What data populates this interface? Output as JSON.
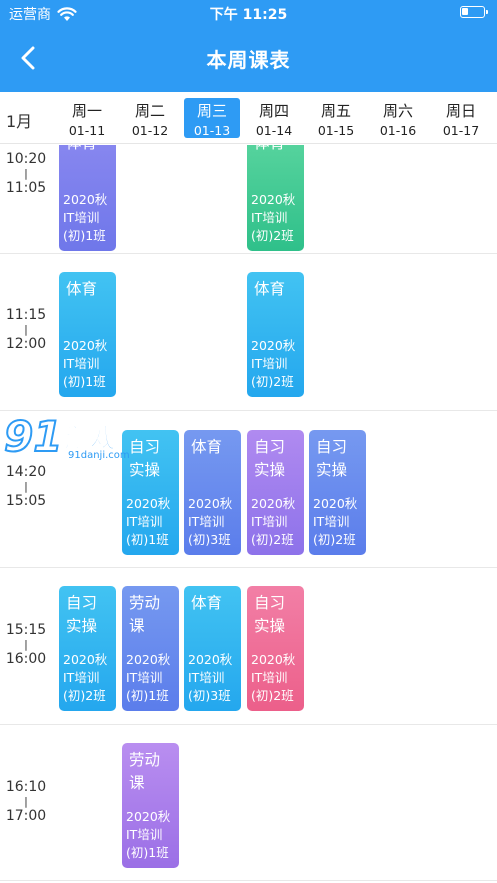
{
  "status_bar": {
    "carrier": "运营商",
    "time": "下午 11:25"
  },
  "nav": {
    "title": "本周课表"
  },
  "week": {
    "month": "1月",
    "days": [
      {
        "name": "周一",
        "date": "01-11",
        "selected": false
      },
      {
        "name": "周二",
        "date": "01-12",
        "selected": false
      },
      {
        "name": "周三",
        "date": "01-13",
        "selected": true
      },
      {
        "name": "周四",
        "date": "01-14",
        "selected": false
      },
      {
        "name": "周五",
        "date": "01-15",
        "selected": false
      },
      {
        "name": "周六",
        "date": "01-16",
        "selected": false
      },
      {
        "name": "周日",
        "date": "01-17",
        "selected": false
      }
    ]
  },
  "periods": [
    {
      "start": "10:20",
      "sep": "|",
      "end": "11:05"
    },
    {
      "start": "11:15",
      "sep": "|",
      "end": "12:00"
    },
    {
      "start": "14:20",
      "sep": "|",
      "end": "15:05"
    },
    {
      "start": "15:15",
      "sep": "|",
      "end": "16:00"
    },
    {
      "start": "16:10",
      "sep": "|",
      "end": "17:00"
    }
  ],
  "courses": [
    {
      "period": 0,
      "day": 0,
      "title": "体育",
      "class": "2020秋IT培训(初)1班",
      "color": "purple"
    },
    {
      "period": 0,
      "day": 3,
      "title": "体育",
      "class": "2020秋IT培训(初)2班",
      "color": "green"
    },
    {
      "period": 1,
      "day": 0,
      "title": "体育",
      "class": "2020秋IT培训(初)1班",
      "color": "blue"
    },
    {
      "period": 1,
      "day": 3,
      "title": "体育",
      "class": "2020秋IT培训(初)2班",
      "color": "blue"
    },
    {
      "period": 2,
      "day": 1,
      "title": "自习实操",
      "class": "2020秋IT培训(初)1班",
      "color": "blue"
    },
    {
      "period": 2,
      "day": 2,
      "title": "体育",
      "class": "2020秋IT培训(初)3班",
      "color": "indigo"
    },
    {
      "period": 2,
      "day": 3,
      "title": "自习实操",
      "class": "2020秋IT培训(初)2班",
      "color": "violet"
    },
    {
      "period": 2,
      "day": 4,
      "title": "自习实操",
      "class": "2020秋IT培训(初)2班",
      "color": "indigo"
    },
    {
      "period": 3,
      "day": 0,
      "title": "自习实操",
      "class": "2020秋IT培训(初)2班",
      "color": "blue"
    },
    {
      "period": 3,
      "day": 1,
      "title": "劳动课",
      "class": "2020秋IT培训(初)1班",
      "color": "indigo"
    },
    {
      "period": 3,
      "day": 2,
      "title": "体育",
      "class": "2020秋IT培训(初)3班",
      "color": "blue"
    },
    {
      "period": 3,
      "day": 3,
      "title": "自习实操",
      "class": "2020秋IT培训(初)2班",
      "color": "pink"
    },
    {
      "period": 4,
      "day": 1,
      "title": "劳动课",
      "class": "2020秋IT培训(初)1班",
      "color": "lilac"
    }
  ],
  "watermark": {
    "number": "91",
    "text": "游戏",
    "url": "91danji.com"
  }
}
